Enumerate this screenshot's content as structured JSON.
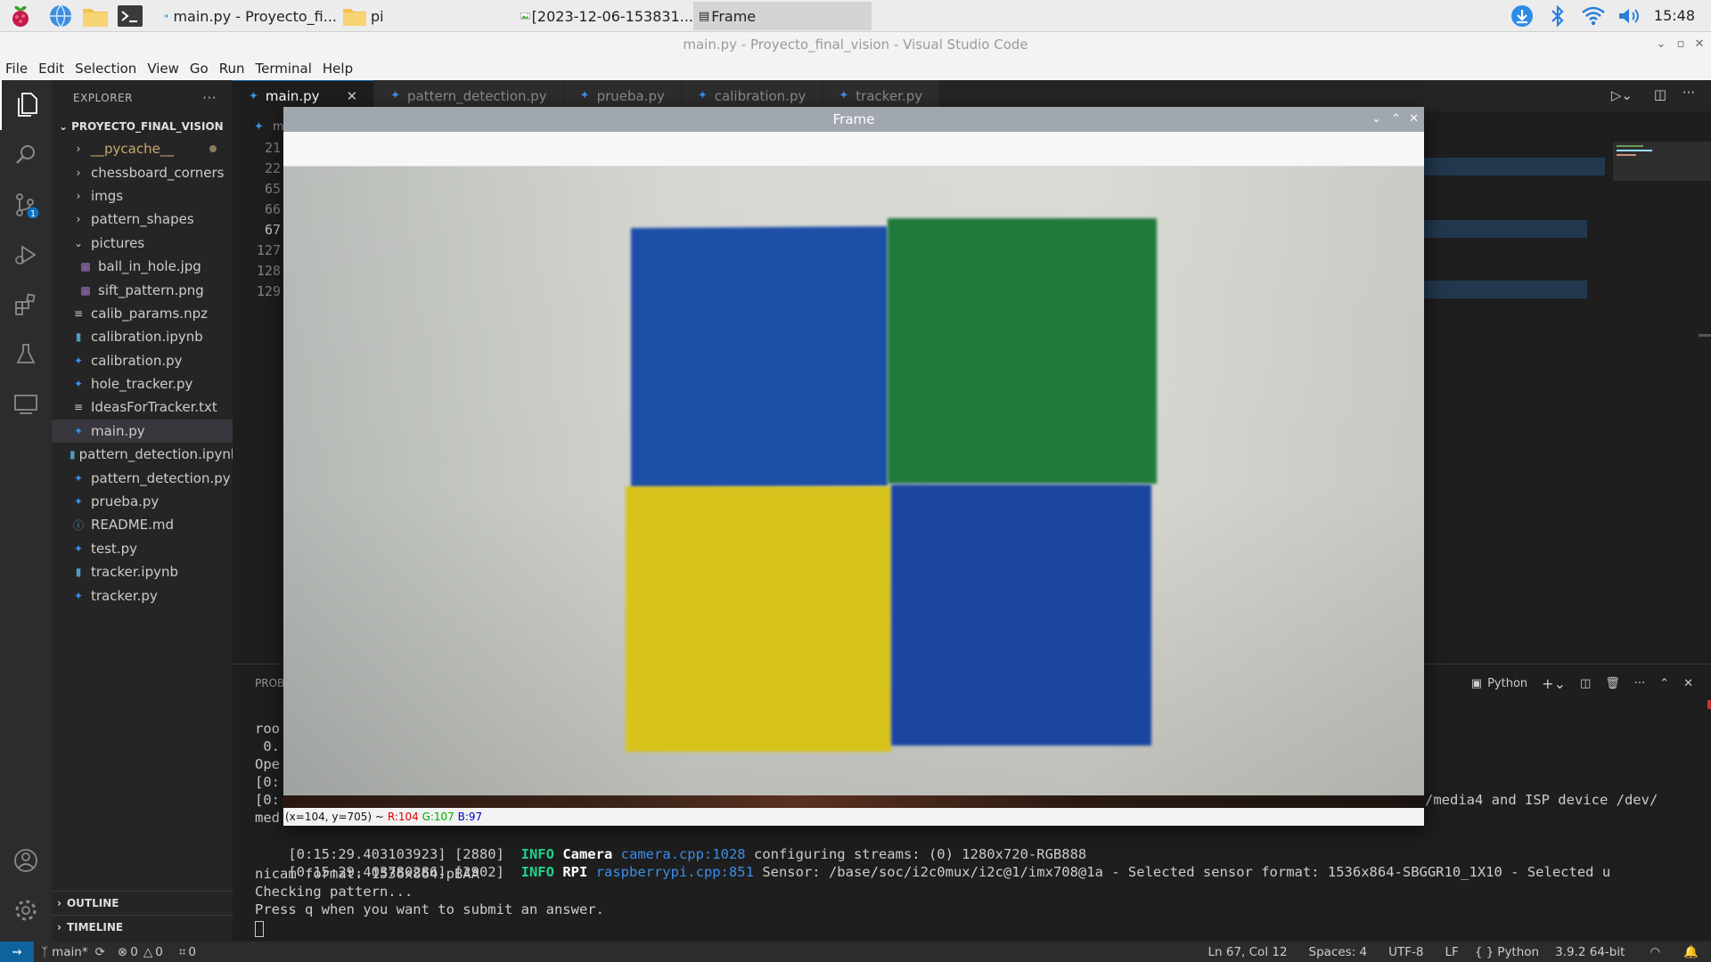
{
  "taskbar": {
    "tasks": [
      {
        "label": "main.py - Proyecto_fi..."
      },
      {
        "label": "pi"
      },
      {
        "label": "[2023-12-06-153831..."
      },
      {
        "label": "Frame"
      }
    ],
    "clock": "15:48"
  },
  "window": {
    "title": "main.py - Proyecto_final_vision - Visual Studio Code"
  },
  "menu": [
    "File",
    "Edit",
    "Selection",
    "View",
    "Go",
    "Run",
    "Terminal",
    "Help"
  ],
  "activity": {
    "scm_badge": "1"
  },
  "explorer": {
    "header": "EXPLORER",
    "more": "···",
    "project": "PROYECTO_FINAL_VISION",
    "items": [
      {
        "label": "__pycache__"
      },
      {
        "label": "chessboard_corners"
      },
      {
        "label": "imgs"
      },
      {
        "label": "pattern_shapes"
      },
      {
        "label": "pictures"
      },
      {
        "label": "ball_in_hole.jpg"
      },
      {
        "label": "sift_pattern.png"
      },
      {
        "label": "calib_params.npz"
      },
      {
        "label": "calibration.ipynb"
      },
      {
        "label": "calibration.py"
      },
      {
        "label": "hole_tracker.py"
      },
      {
        "label": "IdeasForTracker.txt"
      },
      {
        "label": "main.py"
      },
      {
        "label": "pattern_detection.ipynb"
      },
      {
        "label": "pattern_detection.py"
      },
      {
        "label": "prueba.py"
      },
      {
        "label": "README.md"
      },
      {
        "label": "test.py"
      },
      {
        "label": "tracker.ipynb"
      },
      {
        "label": "tracker.py"
      }
    ],
    "outline": "OUTLINE",
    "timeline": "TIMELINE"
  },
  "tabs": [
    {
      "label": "main.py"
    },
    {
      "label": "pattern_detection.py"
    },
    {
      "label": "prueba.py"
    },
    {
      "label": "calibration.py"
    },
    {
      "label": "tracker.py"
    }
  ],
  "editor": {
    "breadcrumb_fragment": "m",
    "line_numbers": [
      "21",
      "22",
      "65",
      "66",
      "67",
      "127",
      "128",
      "129"
    ]
  },
  "panel": {
    "tab_fragment": "PROB",
    "terminal_label": "Python",
    "lines_partial": [
      "roo",
      " 0.",
      "Ope",
      "[0:",
      "[0:",
      "med"
    ],
    "line_tail": "/media4 and ISP device /dev/",
    "log1": {
      "ts": "[0:15:29.403103923] [2880]",
      "level": "INFO",
      "module": "Camera",
      "src": "camera.cpp:1028",
      "msg": "configuring streams: (0) 1280x720-RGB888"
    },
    "log2": {
      "ts": "[0:15:29.403780286] [2902]",
      "level": "INFO",
      "module": "RPI",
      "src": "raspberrypi.cpp:851",
      "msg": "Sensor: /base/soc/i2c0mux/i2c@1/imx708@1a - Selected sensor format: 1536x864-SBGGR10_1X10 - Selected u"
    },
    "log2_cont": "nicam format: 1536x864-pBAA",
    "line_checking": "Checking pattern...",
    "line_prompt": "Press q when you want to submit an answer."
  },
  "statusbar": {
    "branch": "main*",
    "errors": "0",
    "warnings": "0",
    "ports": "0",
    "position": "Ln 67, Col 12",
    "spaces": "Spaces: 4",
    "encoding": "UTF-8",
    "eol": "LF",
    "language": "Python",
    "interpreter": "3.9.2 64-bit"
  },
  "frame_window": {
    "title": "Frame",
    "status_coords": "(x=104, y=705) ~",
    "status_r": "R:104",
    "status_g": "G:107",
    "status_b": "B:97",
    "quadrant_colors": {
      "top_left": "#1e4fa8",
      "top_right": "#1f7a3c",
      "bottom_left": "#d7c31c",
      "bottom_right": "#1a45a0"
    }
  },
  "colors": {
    "accent": "#0e639c",
    "statusbar": "#2c2c2c",
    "terminal_info": "#23d18b",
    "terminal_link": "#3b8eea"
  }
}
